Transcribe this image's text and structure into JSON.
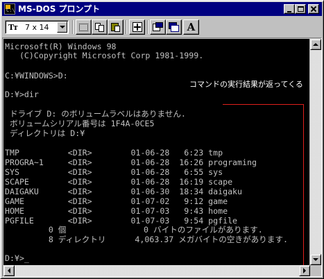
{
  "window": {
    "title": "MS-DOS プロンプト",
    "icon": "ms-dos-prompt-icon",
    "title_bar_color": "#000080"
  },
  "title_buttons": {
    "minimize": "minimize-icon",
    "maximize": "maximize-icon",
    "close": "close-icon"
  },
  "toolbar": {
    "font_type_icon": "Tт",
    "font_size_value": "7 x 14",
    "buttons": [
      "mark-icon",
      "copy-icon",
      "paste-icon",
      "full-screen-icon",
      "properties-icon",
      "background-icon"
    ],
    "font_button_label": "A"
  },
  "console": {
    "background": "#000000",
    "text_color": "#c0c0c0",
    "lines": [
      "Microsoft(R) Windows 98",
      "   (C)Copyright Microsoft Corp 1981-1999.",
      "",
      "C:¥WINDOWS>D:",
      "",
      "D:¥>dir",
      "",
      " ドライブ D: のボリュームラベルはありません.",
      " ボリュームシリアル番号は 1F4A-0CE5",
      " ディレクトリは D:¥",
      "",
      "TMP          <DIR>        01-06-28   6:23 tmp",
      "PROGRA~1     <DIR>        01-06-28  16:26 programing",
      "SYS          <DIR>        01-06-28   6:55 sys",
      "SCAPE        <DIR>        01-06-28  16:19 scape",
      "DAIGAKU      <DIR>        01-06-30  18:34 daigaku",
      "GAME         <DIR>        01-07-02   9:12 game",
      "HOME         <DIR>        01-07-03   9:43 home",
      "PGFILE       <DIR>        01-07-03   9:54 pgfile",
      "         0 個                0 バイトのファイルがあります.",
      "         8 ディレクトリ      4,063.37 メガバイトの空きがあります.",
      "",
      "D:¥>_"
    ]
  },
  "annotation": {
    "text": "コマンドの実行結果が返ってくる",
    "color": "#ffffff",
    "bracket_color": "#e0201c"
  },
  "scrollbars": {
    "vertical": [
      "scroll-up-icon",
      "scroll-down-icon"
    ],
    "horizontal": [
      "scroll-left-icon",
      "scroll-right-icon"
    ]
  }
}
